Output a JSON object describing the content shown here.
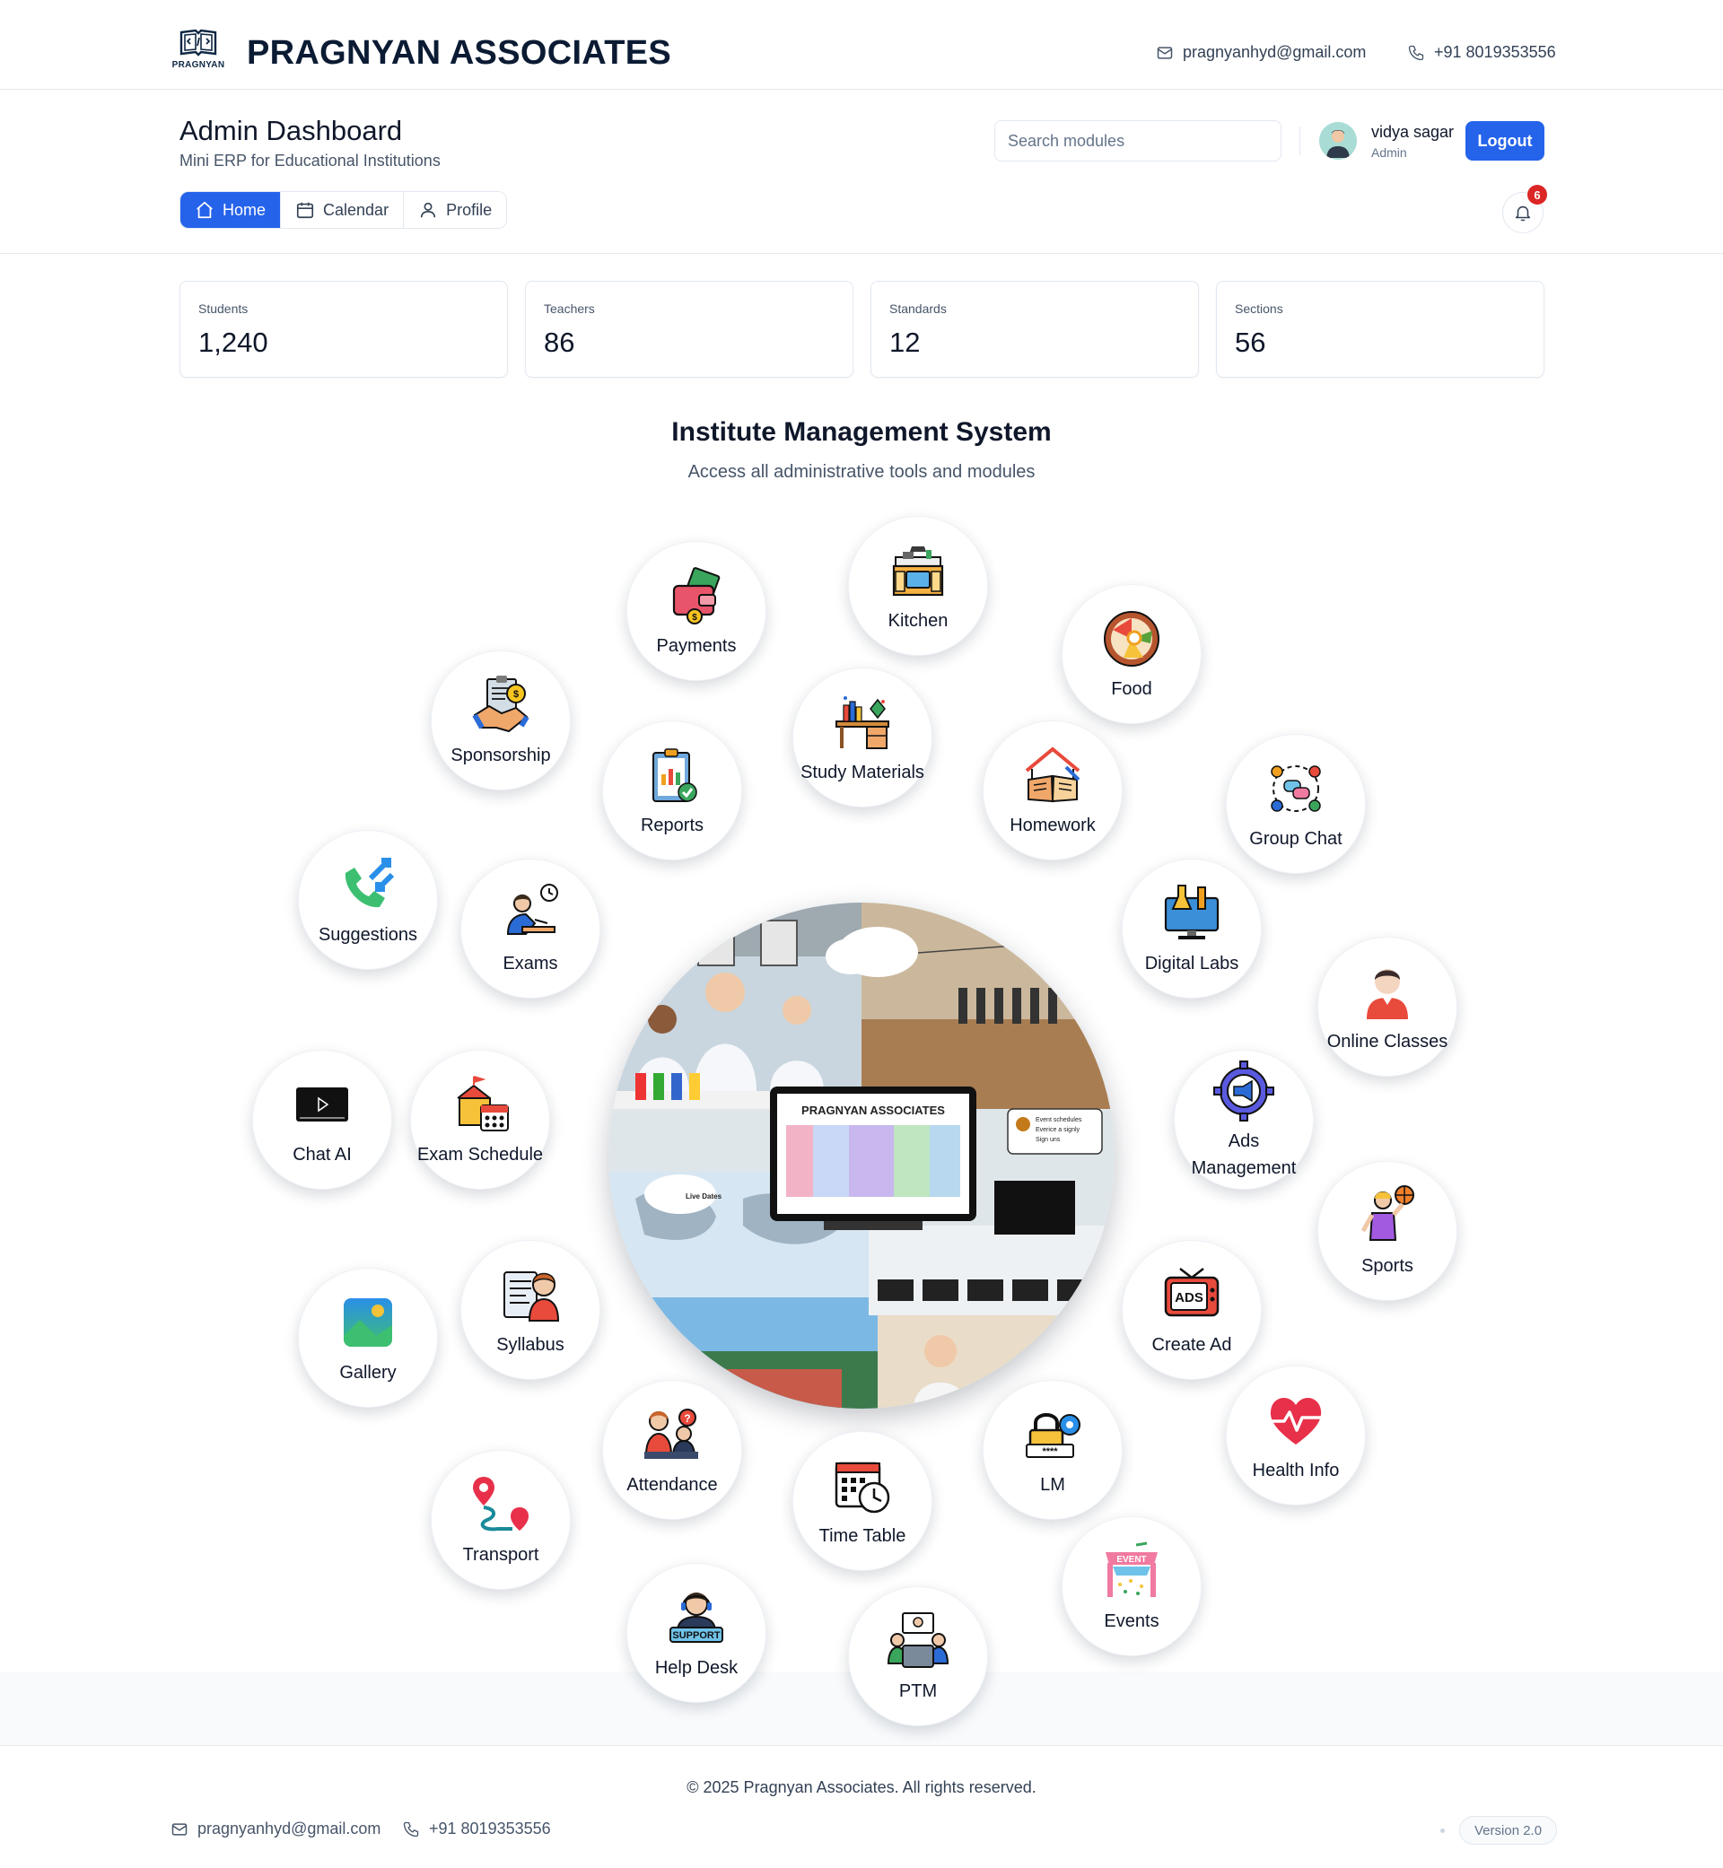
{
  "brand": {
    "name": "PRAGNYAN ASSOCIATES",
    "logo_text": "PRAGNYAN",
    "email": "pragnyanhyd@gmail.com",
    "phone": "+91 8019353556"
  },
  "header": {
    "title": "Admin Dashboard",
    "subtitle": "Mini ERP for Educational Institutions",
    "tabs": [
      {
        "label": "Home",
        "icon": "home-icon",
        "active": true
      },
      {
        "label": "Calendar",
        "icon": "calendar-icon",
        "active": false
      },
      {
        "label": "Profile",
        "icon": "user-icon",
        "active": false
      }
    ],
    "search_placeholder": "Search modules",
    "user": {
      "name": "vidya sagar",
      "role": "Admin"
    },
    "logout_label": "Logout",
    "notifications": "6"
  },
  "stats": [
    {
      "label": "Students",
      "value": "1,240"
    },
    {
      "label": "Teachers",
      "value": "86"
    },
    {
      "label": "Standards",
      "value": "12"
    },
    {
      "label": "Sections",
      "value": "56"
    }
  ],
  "hub": {
    "title": "Institute Management System",
    "subtitle": "Access all administrative tools and modules",
    "center_image": {
      "screen_title": "PRAGNYAN ASSOCIATES",
      "note_line1": "Event schedules",
      "note_line2": "Everice a signly",
      "note_line3": "Sign uns",
      "cloud_label": "Live Dates"
    },
    "modules": [
      {
        "label": "Payments",
        "icon": "wallet-icon"
      },
      {
        "label": "Kitchen",
        "icon": "kitchen-icon"
      },
      {
        "label": "Food",
        "icon": "food-bowl-icon"
      },
      {
        "label": "Sponsorship",
        "icon": "handshake-icon"
      },
      {
        "label": "Reports",
        "icon": "clipboard-chart-icon"
      },
      {
        "label": "Study Materials",
        "icon": "study-desk-icon"
      },
      {
        "label": "Homework",
        "icon": "home-book-icon"
      },
      {
        "label": "Group Chat",
        "icon": "group-chat-icon"
      },
      {
        "label": "Suggestions",
        "icon": "phone-arrows-icon"
      },
      {
        "label": "Exams",
        "icon": "student-writing-icon"
      },
      {
        "label": "Digital Labs",
        "icon": "lab-monitor-icon"
      },
      {
        "label": "Online Classes",
        "icon": "person-icon"
      },
      {
        "label": "Chat AI",
        "icon": "video-player-icon"
      },
      {
        "label": "Exam Schedule",
        "icon": "school-calendar-icon"
      },
      {
        "label": "Ads Management",
        "icon": "megaphone-gear-icon"
      },
      {
        "label": "Sports",
        "icon": "basketball-player-icon"
      },
      {
        "label": "Gallery",
        "icon": "image-icon"
      },
      {
        "label": "Syllabus",
        "icon": "syllabus-icon"
      },
      {
        "label": "Create Ad",
        "icon": "ads-tv-icon"
      },
      {
        "label": "Health Info",
        "icon": "heart-pulse-icon"
      },
      {
        "label": "Attendance",
        "icon": "attendance-icon"
      },
      {
        "label": "Time Table",
        "icon": "timetable-icon"
      },
      {
        "label": "LM",
        "icon": "lock-gear-icon"
      },
      {
        "label": "Transport",
        "icon": "route-pin-icon"
      },
      {
        "label": "Events",
        "icon": "event-banner-icon"
      },
      {
        "label": "Help Desk",
        "icon": "support-agent-icon"
      },
      {
        "label": "PTM",
        "icon": "meeting-icon"
      }
    ]
  },
  "footer": {
    "copyright": "© 2025 Pragnyan Associates. All rights reserved.",
    "email": "pragnyanhyd@gmail.com",
    "phone": "+91 8019353556",
    "version": "Version 2.0"
  },
  "colors": {
    "primary": "#2563eb",
    "badge": "#dc2626",
    "brand_dark": "#0b1b33"
  }
}
